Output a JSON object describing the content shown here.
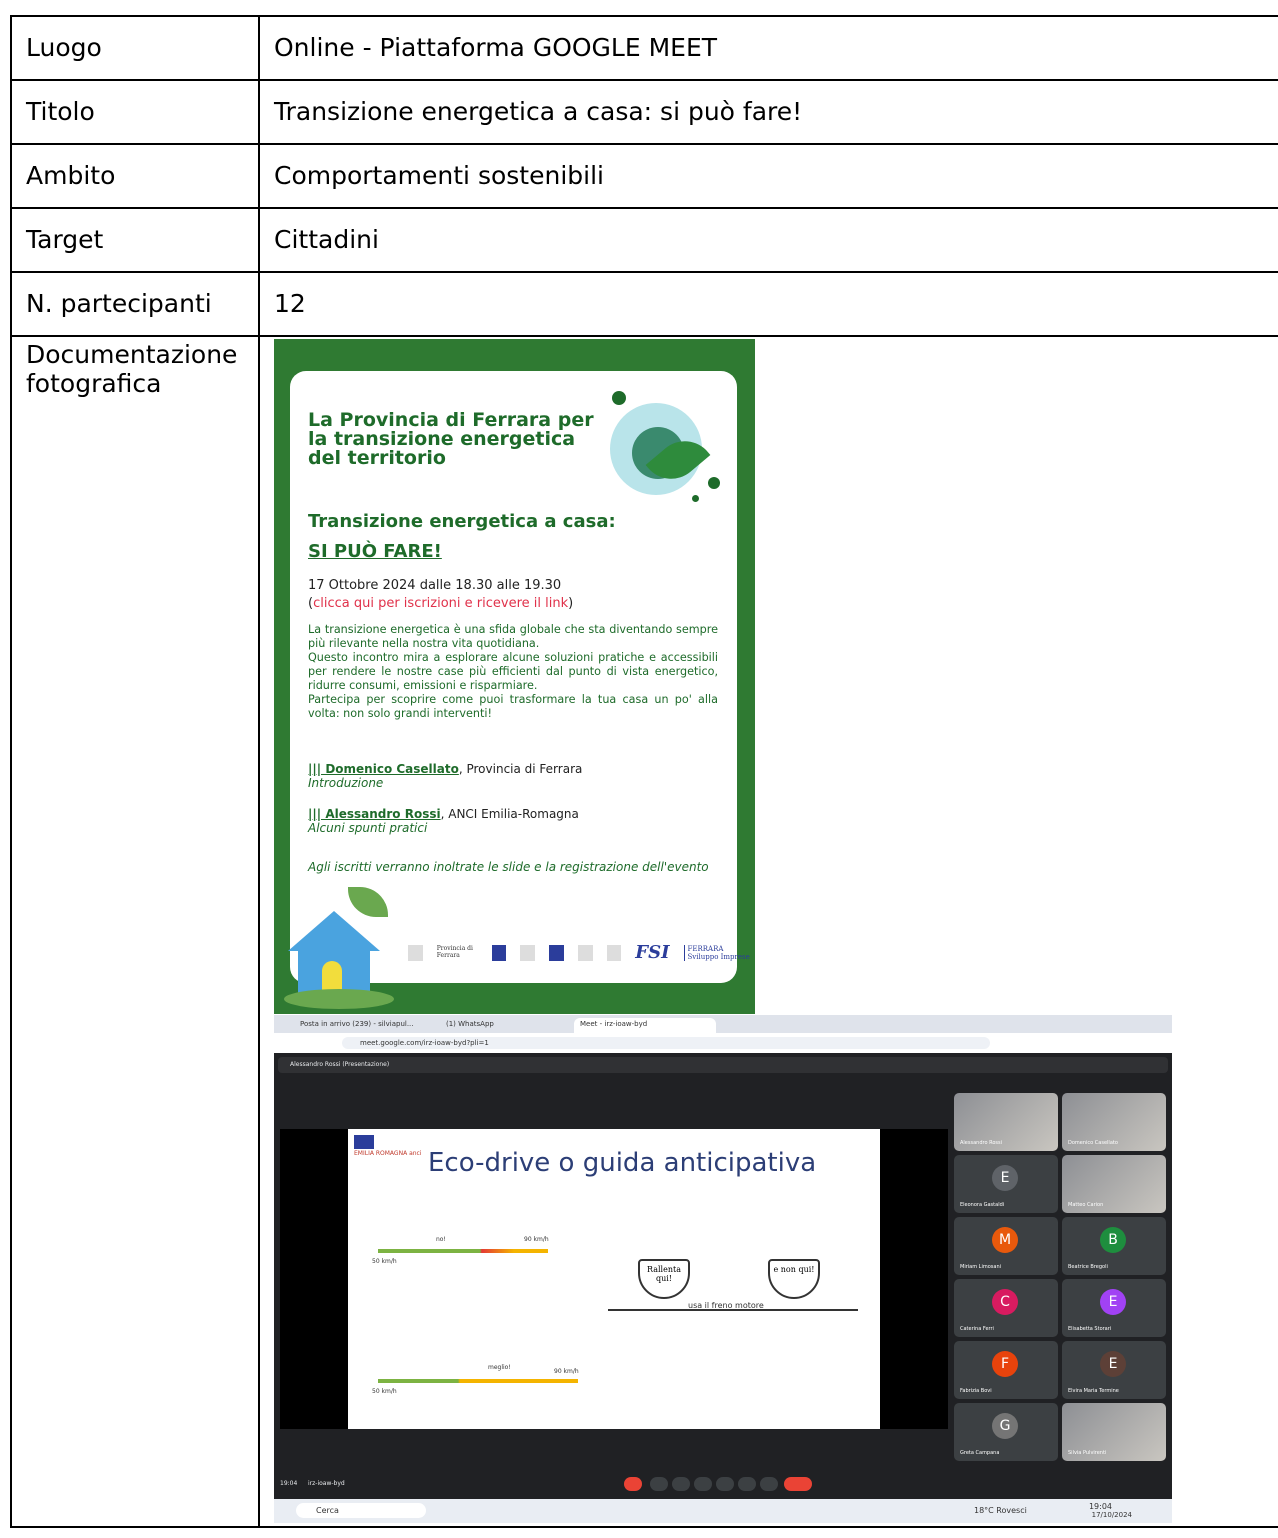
{
  "rows": [
    {
      "label": "Luogo",
      "value": "Online - Piattaforma GOOGLE MEET"
    },
    {
      "label": "Titolo",
      "value": "Transizione energetica a casa: si può fare!"
    },
    {
      "label": "Ambito",
      "value": "Comportamenti sostenibili"
    },
    {
      "label": "Target",
      "value": "Cittadini"
    },
    {
      "label": "N. partecipanti",
      "value": "12"
    }
  ],
  "doc_label": "Documentazione fotografica",
  "flyer": {
    "headline": "La Provincia di Ferrara per la transizione energetica del territorio",
    "subtitle": "Transizione energetica a casa:",
    "subtitle2": "SI PUÒ FARE!",
    "date": "17 Ottobre 2024 dalle 18.30 alle 19.30",
    "link_open": "(",
    "link": "clicca qui per iscrizioni e ricevere il link",
    "link_close": ")",
    "body1": "La transizione energetica è una sfida globale che sta diventando sempre più rilevante nella nostra vita quotidiana.",
    "body2": "Questo incontro mira a esplorare alcune soluzioni pratiche e accessibili per rendere le nostre case più efficienti dal punto di vista energetico, ridurre consumi, emissioni e risparmiare.",
    "body3": "Partecipa per scoprire come puoi trasformare la tua casa un po' alla volta: non solo grandi interventi!",
    "speaker1_name": "||| Domenico Casellato",
    "speaker1_org": ", Provincia di Ferrara",
    "speaker1_role": "Introduzione",
    "speaker2_name": "||| Alessandro Rossi",
    "speaker2_org": ", ANCI Emilia-Romagna",
    "speaker2_role": "Alcuni spunti pratici",
    "footer": "Agli iscritti verranno inoltrate le slide e la registrazione dell'evento",
    "logo_provincia": "Provincia di Ferrara",
    "logo_fsi": "FSI",
    "logo_fsi_text": "FERRARA Sviluppo Imprese"
  },
  "screenshot": {
    "tab1": "Posta in arrivo (239) - silviapul...",
    "tab2": "(1) WhatsApp",
    "tab3": "Meet - irz-ioaw-byd",
    "url": "meet.google.com/irz-ioaw-byd?pli=1",
    "presenter": "Alessandro Rossi (Presentazione)",
    "slide_title": "Eco-drive o guida anticipativa",
    "slide_logo": "EMILIA ROMAGNA anci",
    "sign1": "Rallenta qui!",
    "sign2": "e non qui!",
    "freno": "usa il freno motore",
    "lbl_no": "no!",
    "lbl_meglio": "meglio!",
    "lbl_50a": "50 km/h",
    "lbl_90a": "90 km/h",
    "lbl_50b": "50 km/h",
    "lbl_90b": "90 km/h",
    "participants": [
      {
        "name": "Alessandro Rossi",
        "initial": "",
        "color": ""
      },
      {
        "name": "Domenico Casellato",
        "initial": "",
        "color": ""
      },
      {
        "name": "Eleonora Gastaldi",
        "initial": "E",
        "color": "#5f6368"
      },
      {
        "name": "Matteo Carion",
        "initial": "",
        "color": ""
      },
      {
        "name": "Miriam Limosani",
        "initial": "M",
        "color": "#e8590c"
      },
      {
        "name": "Beatrice Bregoli",
        "initial": "B",
        "color": "#1e8e3e"
      },
      {
        "name": "Caterina Ferri",
        "initial": "C",
        "color": "#d81b60"
      },
      {
        "name": "Elisabetta Storari",
        "initial": "E",
        "color": "#a142f4"
      },
      {
        "name": "Fabrizia Bovi",
        "initial": "F",
        "color": "#e8430c"
      },
      {
        "name": "Elvira Maria Termine",
        "initial": "E",
        "color": "#5d4037"
      },
      {
        "name": "Greta Campana",
        "initial": "G",
        "color": "#757575"
      },
      {
        "name": "Silvia Pulvirenti",
        "initial": "",
        "color": ""
      }
    ],
    "time": "19:04",
    "meeting_code": "irz-ioaw-byd",
    "search": "Cerca",
    "weather": "18°C Rovesci",
    "clock_time": "19:04",
    "clock_date": "17/10/2024"
  }
}
